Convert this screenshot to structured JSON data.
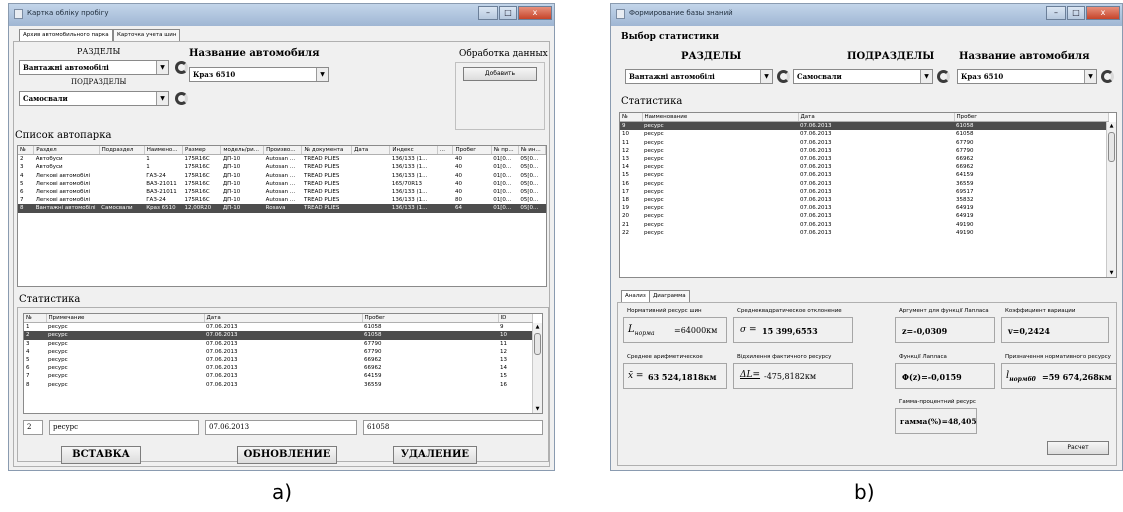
{
  "window_a": {
    "title": "Картка обліку пробігу",
    "tabs": [
      "Архив автомобильного парка",
      "Карточка учета шин"
    ],
    "razdely_label": "РАЗДЕЛЫ",
    "razdely_value": "Вантажні автомобілі",
    "podrazdely_label": "ПОДРАЗДЕЛЫ",
    "podrazdely_value": "Самосвали",
    "car_name_label": "Название автомобиля",
    "car_name_value": "Краз 6510",
    "processing_label": "Обработка данных",
    "add_button": "Добавить",
    "fleet_list_label": "Список автопарка",
    "fleet_columns": [
      "№",
      "Раздел",
      "Подраздел",
      "Наимено...",
      "Размер",
      "модель/ри...",
      "Произво...",
      "№ документа",
      "Дата",
      "Индекс",
      "...",
      "Пробег",
      "№ пр...",
      "№ ин..."
    ],
    "fleet_rows": [
      [
        "2",
        "Автобуси",
        "",
        "1",
        "175R16C",
        "ДП-10",
        "Autosan ...",
        "TREAD PLIES",
        "",
        "136/133 (1...",
        "",
        "40",
        "01[0...",
        "05[0..."
      ],
      [
        "3",
        "Автобуси",
        "",
        "1",
        "175R16C",
        "ДП-10",
        "Autosan ...",
        "TREAD PLIES",
        "",
        "136/133 (1...",
        "",
        "40",
        "01[0...",
        "05[0..."
      ],
      [
        "4",
        "Легкові автомобілі",
        "",
        "ГАЗ-24",
        "175R16C",
        "ДП-10",
        "Autosan ...",
        "TREAD PLIES",
        "",
        "136/133 (1...",
        "",
        "40",
        "01[0...",
        "05[0..."
      ],
      [
        "5",
        "Легкові автомобілі",
        "",
        "ВАЗ-21011",
        "175R16C",
        "ДП-10",
        "Autosan ...",
        "TREAD PLIES",
        "",
        "165/70R13",
        "",
        "40",
        "01[0...",
        "05[0..."
      ],
      [
        "6",
        "Легкові автомобілі",
        "",
        "ВАЗ-21011",
        "175R16C",
        "ДП-10",
        "Autosan ...",
        "TREAD PLIES",
        "",
        "136/133 (1...",
        "",
        "40",
        "01[0...",
        "05[0..."
      ],
      [
        "7",
        "Легкові автомобілі",
        "",
        "ГАЗ-24",
        "175R16C",
        "ДП-10",
        "Autosan ...",
        "TREAD PLIES",
        "",
        "136/133 (1...",
        "",
        "80",
        "01[0...",
        "05[0..."
      ],
      [
        "8",
        "Вантажні автомобілі",
        "Самосвали",
        "Краз 6510",
        "12,00R20",
        "ДП-10",
        "Rosava",
        "TREAD PLIES",
        "",
        "136/133 (1...",
        "",
        "64",
        "01[0...",
        "05[0..."
      ]
    ],
    "fleet_selected_index": 6,
    "stats_label": "Статистика",
    "stats_columns": [
      "№",
      "Примечание",
      "Дата",
      "Пробег",
      "ID"
    ],
    "stats_rows": [
      [
        "1",
        "ресурс",
        "07.06.2013",
        "61058",
        "9"
      ],
      [
        "2",
        "ресурс",
        "07.06.2013",
        "61058",
        "10"
      ],
      [
        "3",
        "ресурс",
        "07.06.2013",
        "67790",
        "11"
      ],
      [
        "4",
        "ресурс",
        "07.06.2013",
        "67790",
        "12"
      ],
      [
        "5",
        "ресурс",
        "07.06.2013",
        "66962",
        "13"
      ],
      [
        "6",
        "ресурс",
        "07.06.2013",
        "66962",
        "14"
      ],
      [
        "7",
        "ресурс",
        "07.06.2013",
        "64159",
        "15"
      ],
      [
        "8",
        "ресурс",
        "07.06.2013",
        "36559",
        "16"
      ]
    ],
    "stats_selected_index": 1,
    "edit_fields": {
      "num": "2",
      "note": "ресурс",
      "date": "07.06.2013",
      "mileage": "61058"
    },
    "insert_button": "ВСТАВКА",
    "update_button": "ОБНОВЛЕНИЕ",
    "delete_button": "УДАЛЕНИЕ"
  },
  "window_b": {
    "title": "Формирование базы знаний",
    "select_stats_label": "Выбор статистики",
    "razdely_label": "РАЗДЕЛЫ",
    "razdely_value": "Вантажні автомобілі",
    "podrazdely_label": "ПОДРАЗДЕЛЫ",
    "podrazdely_value": "Самосвали",
    "car_name_label": "Название автомобиля",
    "car_name_value": "Краз 6510",
    "stats_label": "Статистика",
    "stats_columns": [
      "№",
      "Наименование",
      "Дата",
      "Пробег"
    ],
    "stats_rows": [
      [
        "9",
        "ресурс",
        "07.06.2013",
        "61058"
      ],
      [
        "10",
        "ресурс",
        "07.06.2013",
        "61058"
      ],
      [
        "11",
        "ресурс",
        "07.06.2013",
        "67790"
      ],
      [
        "12",
        "ресурс",
        "07.06.2013",
        "67790"
      ],
      [
        "13",
        "ресурс",
        "07.06.2013",
        "66962"
      ],
      [
        "14",
        "ресурс",
        "07.06.2013",
        "66962"
      ],
      [
        "15",
        "ресурс",
        "07.06.2013",
        "64159"
      ],
      [
        "16",
        "ресурс",
        "07.06.2013",
        "36559"
      ],
      [
        "17",
        "ресурс",
        "07.06.2013",
        "69517"
      ],
      [
        "18",
        "ресурс",
        "07.06.2013",
        "35832"
      ],
      [
        "19",
        "ресурс",
        "07.06.2013",
        "64919"
      ],
      [
        "20",
        "ресурс",
        "07.06.2013",
        "64919"
      ],
      [
        "21",
        "ресурс",
        "07.06.2013",
        "49190"
      ],
      [
        "22",
        "ресурс",
        "07.06.2013",
        "49190"
      ]
    ],
    "stats_selected_index": 0,
    "tabs": [
      "Анализ",
      "Диаграмма"
    ],
    "analysis": {
      "norm_resource_label": "Нормативний ресурс шин",
      "norm_resource_symbol": "L",
      "norm_resource_sub": "норма",
      "norm_resource_value": "=64000км",
      "std_dev_label": "Среднеквадратическое отклонение",
      "std_dev_symbol": "σ =",
      "std_dev_value": "15 399,6553",
      "laplace_arg_label": "Аргумент для функції Лапласа",
      "laplace_arg_value": "z=-0,0309",
      "variation_label": "Коэффициент вариации",
      "variation_value": "v=0,2424",
      "mean_label": "Среднее арифметическое",
      "mean_symbol": "x̄ =",
      "mean_value": "63 524,1818км",
      "deviation_label": "Відхилення фактичного ресурсу",
      "deviation_symbol": "ΔL=",
      "deviation_value": "-475,8182км",
      "laplace_label": "Функції Лапласа",
      "laplace_value": "Φ(z)=-0,0159",
      "assigned_label": "Призначення нормативного ресурсу",
      "assigned_symbol": "l",
      "assigned_sub": "норм60",
      "assigned_value": "=59 674,268км",
      "gamma_label": "Гамма-процентний ресурс",
      "gamma_value": "гамма(%)=48,405",
      "calc_button": "Расчет"
    }
  },
  "caption_a": "a)",
  "caption_b": "b)"
}
